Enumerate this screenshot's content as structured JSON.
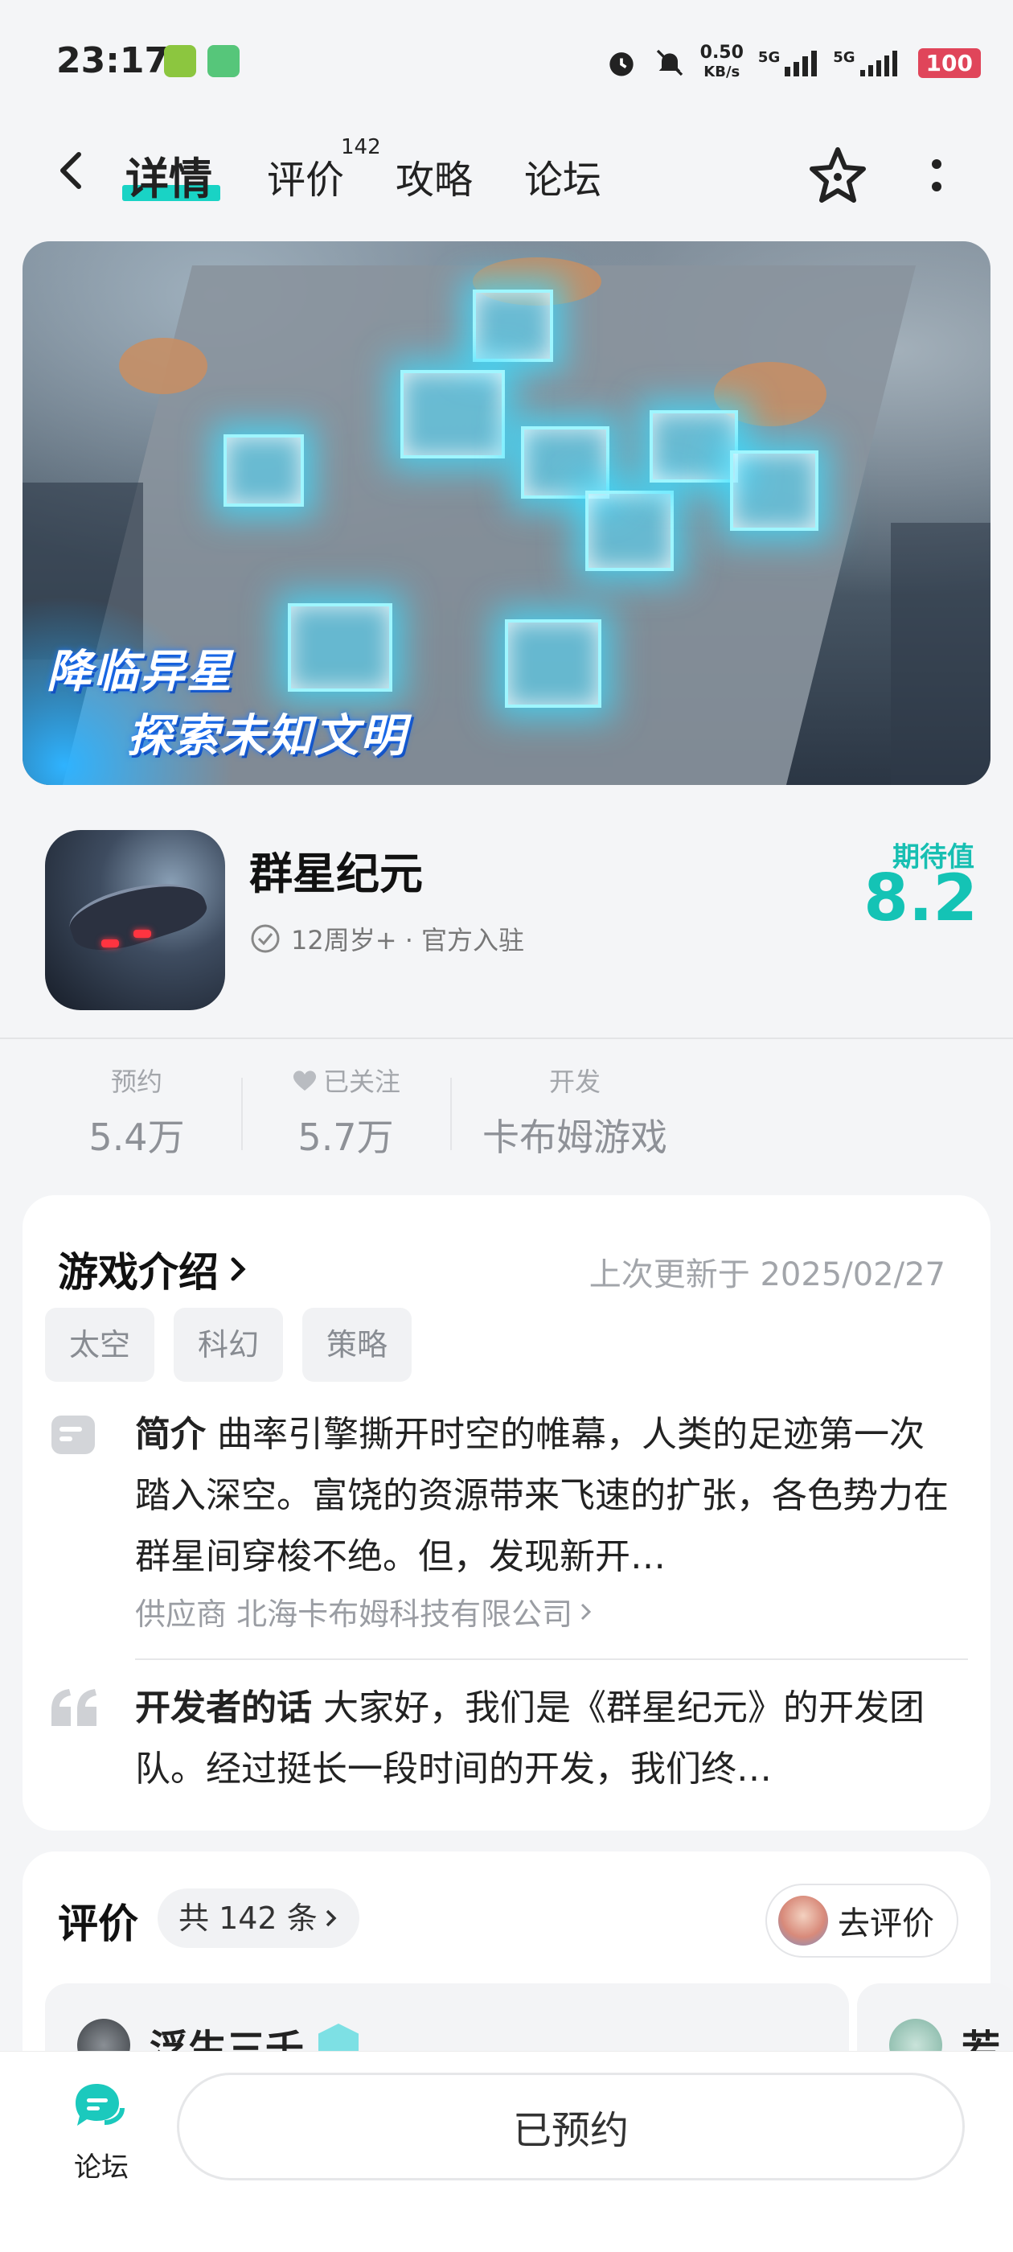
{
  "status_bar": {
    "time": "23:17",
    "net_speed_value": "0.50",
    "net_speed_unit": "KB/s",
    "signal1_label": "5G",
    "signal2_label": "5G",
    "battery": "100"
  },
  "nav": {
    "tabs": [
      {
        "label": "详情",
        "active": true
      },
      {
        "label": "评价",
        "badge": "142"
      },
      {
        "label": "攻略"
      },
      {
        "label": "论坛"
      }
    ]
  },
  "banner": {
    "line1": "降临异星",
    "line2": "探索未知文明"
  },
  "game": {
    "name": "群星纪元",
    "meta": "12周岁+ · 官方入驻",
    "expect_label": "期待值",
    "expect_value": "8.2"
  },
  "stats": [
    {
      "label": "预约",
      "value": "5.4万"
    },
    {
      "label": "已关注",
      "value": "5.7万"
    },
    {
      "label": "开发",
      "value": "卡布姆游戏"
    }
  ],
  "intro": {
    "title": "游戏介绍",
    "updated": "上次更新于 2025/02/27",
    "tags": [
      "太空",
      "科幻",
      "策略"
    ],
    "summary_label": "简介",
    "summary_text": " 曲率引擎撕开时空的帷幕，人类的足迹第一次踏入深空。富饶的资源带来飞速的扩张，各色势力在群星间穿梭不绝。但，发现新开…",
    "supplier": "供应商 北海卡布姆科技有限公司",
    "dev_label": "开发者的话",
    "dev_text": " 大家好，我们是《群星纪元》的开发团队。经过挺长一段时间的开发，我们终…"
  },
  "reviews": {
    "title": "评价",
    "count_label": "共 142 条",
    "rate_button": "去评价",
    "items": [
      {
        "name": "浮生三千"
      },
      {
        "name": "若"
      }
    ]
  },
  "bottom": {
    "forum_label": "论坛",
    "main_button": "已预约"
  },
  "colors": {
    "accent": "#14c3b5",
    "battery": "#e0455a"
  }
}
